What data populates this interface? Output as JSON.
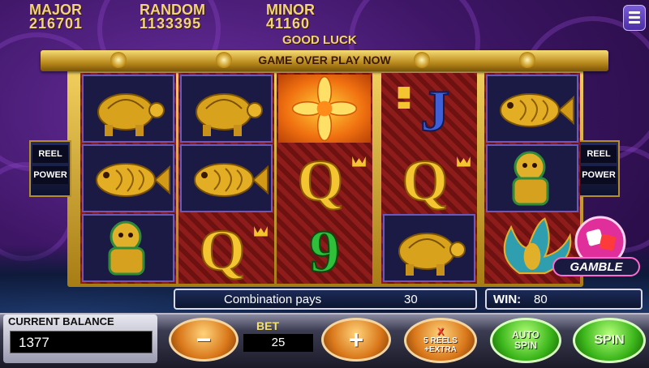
{
  "jackpots": [
    {
      "label": "MAJOR",
      "value": "216701"
    },
    {
      "label": "RANDOM",
      "value": "1133395"
    },
    {
      "label": "MINOR",
      "value": "41160"
    }
  ],
  "good_luck": "GOOD LUCK",
  "banner": "GAME OVER PLAY NOW",
  "side_boxes": {
    "line1": "REEL",
    "line2": "POWER"
  },
  "reels": [
    [
      "turtle",
      "fish",
      "lion"
    ],
    [
      "turtle",
      "fish",
      "Q"
    ],
    [
      "flower",
      "Q",
      "9"
    ],
    [
      "J",
      "Q",
      "turtle"
    ],
    [
      "fish",
      "lion",
      "phoenix"
    ]
  ],
  "gamble_label": "GAMBLE",
  "pay_bar": {
    "label": "Combination pays",
    "value": "30"
  },
  "win_bar": {
    "label": "WIN:",
    "value": "80"
  },
  "balance": {
    "label": "CURRENT BALANCE",
    "value": "1377"
  },
  "bet": {
    "label": "BET",
    "value": "25"
  },
  "buttons": {
    "minus": "−",
    "plus": "+",
    "reels_x": "X",
    "reels_line1": "5 REELS",
    "reels_line2": "+EXTRA",
    "auto_line1": "AUTO",
    "auto_line2": "SPIN",
    "spin": "SPIN"
  },
  "colors": {
    "jackpot_text": "#f3d37a",
    "reel_red": "#8d1c1a",
    "spin_green": "#3ab51a",
    "button_gold": "#d9771a"
  }
}
